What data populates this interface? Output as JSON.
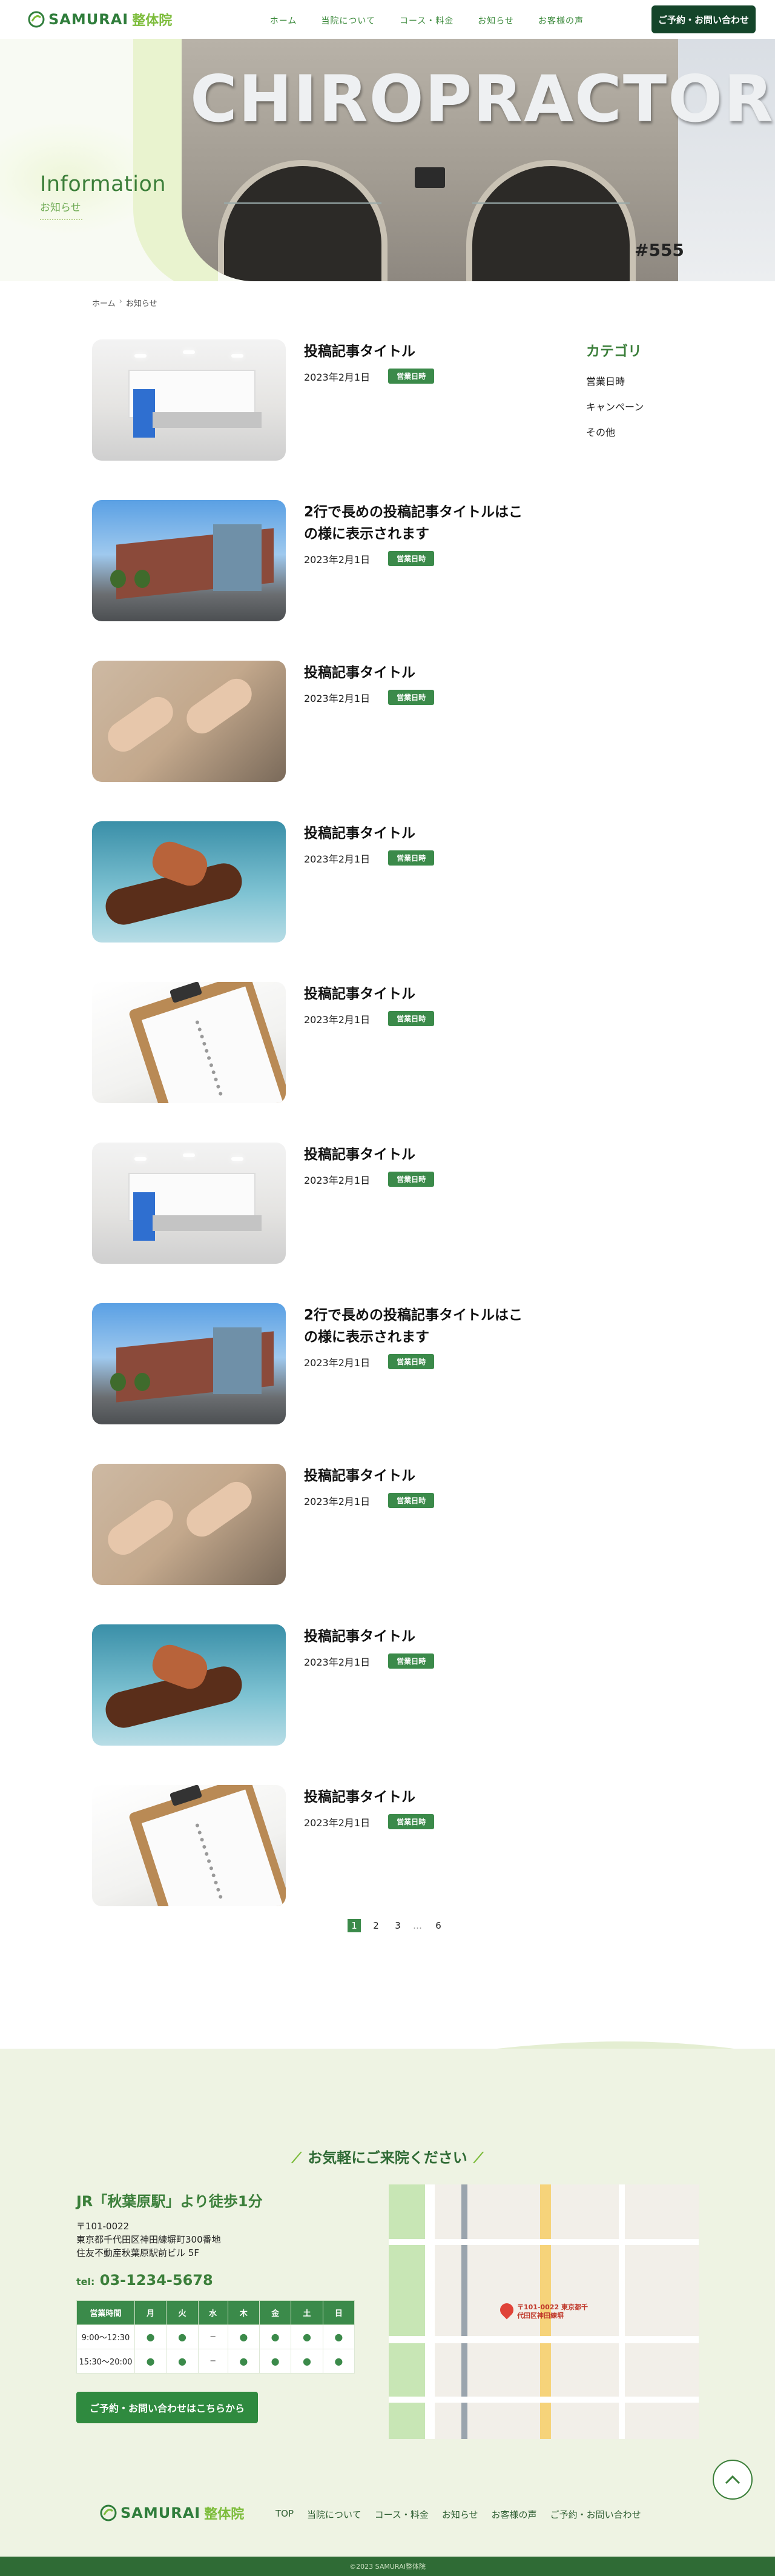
{
  "header": {
    "logo_text": "SAMURAI",
    "logo_suffix": "整体院",
    "nav": [
      "ホーム",
      "当院について",
      "コース・料金",
      "お知らせ",
      "お客様の声"
    ],
    "cta": "ご予約・お問い合わせ"
  },
  "hero": {
    "title_en": "Information",
    "title_ja": "お知らせ",
    "photo_sign": "CHIROPRACTOR",
    "photo_number": "#555"
  },
  "breadcrumb": {
    "home": "ホーム",
    "sep": "›",
    "current": "お知らせ"
  },
  "posts": [
    {
      "title": "投稿記事タイトル",
      "date": "2023年2月1日",
      "tag": "営業日時",
      "thumb": "lobby"
    },
    {
      "title": "2行で長めの投稿記事タイトルはこの様に表示されます",
      "date": "2023年2月1日",
      "tag": "営業日時",
      "thumb": "building"
    },
    {
      "title": "投稿記事タイトル",
      "date": "2023年2月1日",
      "tag": "営業日時",
      "thumb": "massage"
    },
    {
      "title": "投稿記事タイトル",
      "date": "2023年2月1日",
      "tag": "営業日時",
      "thumb": "foot"
    },
    {
      "title": "投稿記事タイトル",
      "date": "2023年2月1日",
      "tag": "営業日時",
      "thumb": "spine"
    },
    {
      "title": "投稿記事タイトル",
      "date": "2023年2月1日",
      "tag": "営業日時",
      "thumb": "lobby"
    },
    {
      "title": "2行で長めの投稿記事タイトルはこの様に表示されます",
      "date": "2023年2月1日",
      "tag": "営業日時",
      "thumb": "building"
    },
    {
      "title": "投稿記事タイトル",
      "date": "2023年2月1日",
      "tag": "営業日時",
      "thumb": "massage"
    },
    {
      "title": "投稿記事タイトル",
      "date": "2023年2月1日",
      "tag": "営業日時",
      "thumb": "foot"
    },
    {
      "title": "投稿記事タイトル",
      "date": "2023年2月1日",
      "tag": "営業日時",
      "thumb": "spine"
    }
  ],
  "sidebar": {
    "heading": "カテゴリ",
    "categories": [
      "営業日時",
      "キャンペーン",
      "その他"
    ]
  },
  "pagination": {
    "pages": [
      "1",
      "2",
      "3"
    ],
    "ellipsis": "…",
    "last": "6",
    "current": "1"
  },
  "footer": {
    "visit_title": "お気軽にご来院ください",
    "access": "JR「秋葉原駅」より徒歩1分",
    "postal": "〒101-0022",
    "address1": "東京都千代田区神田練塀町300番地",
    "address2": "住友不動産秋葉原駅前ビル 5F",
    "tel_label": "tel:",
    "tel": "03-1234-5678",
    "hours_header": [
      "営業時間",
      "月",
      "火",
      "水",
      "木",
      "金",
      "土",
      "日"
    ],
    "hours_rows": [
      {
        "time": "9:00〜12:30",
        "days": [
          "●",
          "●",
          "−",
          "●",
          "●",
          "●",
          "●"
        ]
      },
      {
        "time": "15:30〜20:00",
        "days": [
          "●",
          "●",
          "−",
          "●",
          "●",
          "●",
          "●"
        ]
      }
    ],
    "cta": "ご予約・お問い合わせはこちらから",
    "map_pin_label": "〒101-0022 東京都千代田区神田練塀",
    "nav": [
      "TOP",
      "当院について",
      "コース・料金",
      "お知らせ",
      "お客様の声",
      "ご予約・お問い合わせ"
    ],
    "copyright": "©2023 SAMURAI整体院"
  },
  "colors": {
    "brand_green": "#3b8a4a",
    "dark_green": "#14452a",
    "light_green": "#7cbc3a",
    "footer_bg": "#eef3e3"
  }
}
